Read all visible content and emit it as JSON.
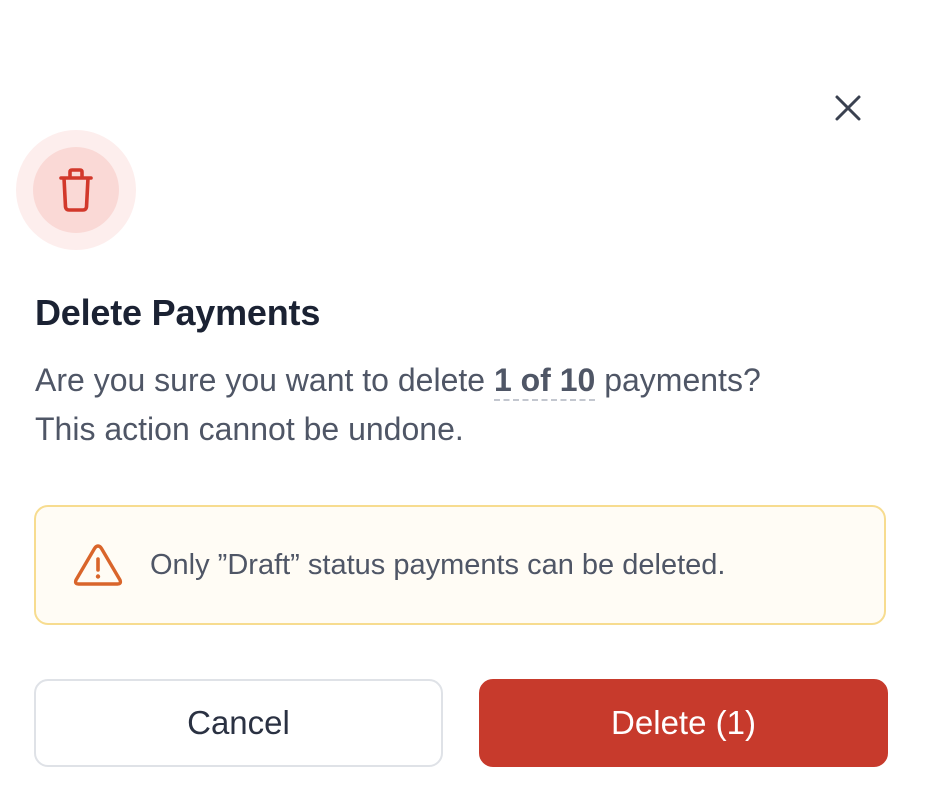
{
  "dialog": {
    "title": "Delete Payments",
    "description_prefix": "Are you sure you want to delete ",
    "description_count": "1 of 10",
    "description_suffix": " payments?",
    "description_line2": "This action cannot be undone.",
    "warning_text": "Only ”Draft” status payments can be deleted.",
    "cancel_label": "Cancel",
    "delete_label": "Delete (1)"
  },
  "icons": {
    "close": "close-icon",
    "header": "trash-icon",
    "warning": "warning-triangle-icon"
  },
  "colors": {
    "danger": "#c73a2c",
    "danger_soft": "#fad9d6",
    "danger_halo": "#fdeeed",
    "warning_border": "#f7dc8f",
    "warning_bg": "#fffcf5",
    "warning_icon": "#d9652b",
    "title": "#1b2233",
    "body_text": "#4f5666"
  }
}
